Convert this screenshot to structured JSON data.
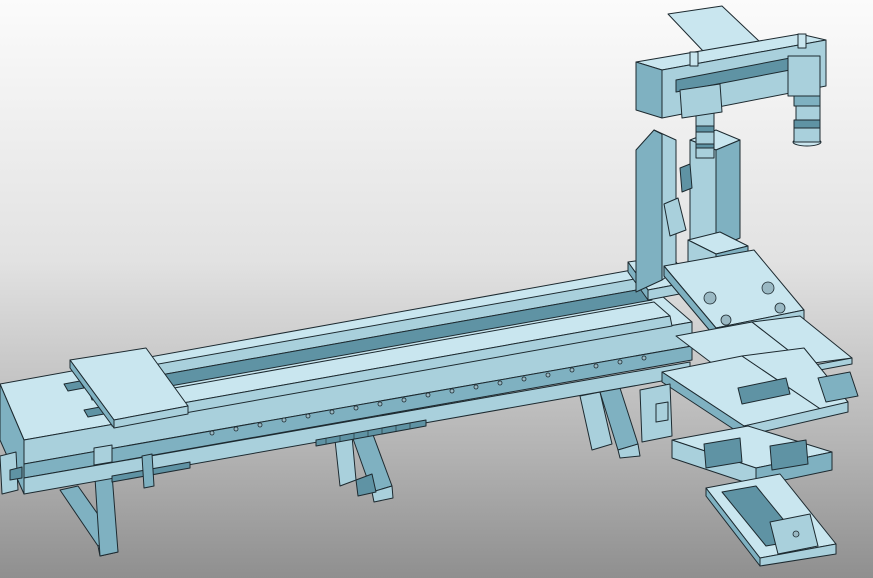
{
  "scene": {
    "background_top": "#fbfbfb",
    "background_bottom": "#8f8f8f",
    "model_color": "#a9d0dc",
    "edge_color": "#1d2a30"
  }
}
